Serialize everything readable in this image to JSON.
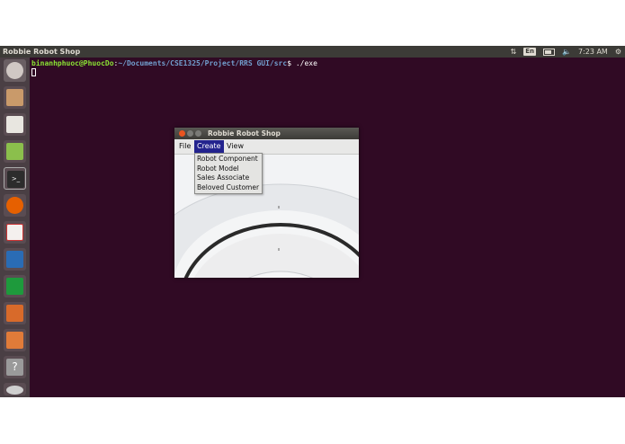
{
  "topbar": {
    "title": "Robbie Robot Shop",
    "keyboard_layout": "En",
    "time": "7:23 AM",
    "icons": [
      "network-icon",
      "keyboard-icon",
      "battery-icon",
      "volume-icon",
      "settings-gear-icon"
    ]
  },
  "launcher": {
    "items": [
      {
        "icon": "dash-home-icon"
      },
      {
        "icon": "file-manager-icon"
      },
      {
        "icon": "text-editor-icon"
      },
      {
        "icon": "system-monitor-icon"
      },
      {
        "icon": "terminal-icon"
      },
      {
        "icon": "firefox-icon"
      },
      {
        "icon": "pdf-viewer-icon"
      },
      {
        "icon": "libreoffice-writer-icon"
      },
      {
        "icon": "libreoffice-calc-icon"
      },
      {
        "icon": "libreoffice-impress-icon"
      },
      {
        "icon": "software-center-icon"
      },
      {
        "icon": "help-icon"
      },
      {
        "icon": "dvd-icon"
      }
    ]
  },
  "terminal": {
    "prompt_user": "binanhphuoc@PhuocDo",
    "prompt_sep": ":",
    "prompt_path": "~/Documents/CSE1325/Project/RRS GUI/src",
    "prompt_end": "$ ",
    "command": "./exe"
  },
  "app_window": {
    "title": "Robbie Robot Shop",
    "menus": [
      {
        "label": "File"
      },
      {
        "label": "Create"
      },
      {
        "label": "View"
      }
    ],
    "create_menu_items": [
      {
        "label": "Robot Component"
      },
      {
        "label": "Robot Model"
      },
      {
        "label": "Sales Associate"
      },
      {
        "label": "Beloved Customer"
      }
    ]
  },
  "colors": {
    "desktop_bg": "#300a24",
    "panel_bg": "#3c3b37",
    "menu_highlight": "#23238e",
    "close_button": "#e95420"
  }
}
